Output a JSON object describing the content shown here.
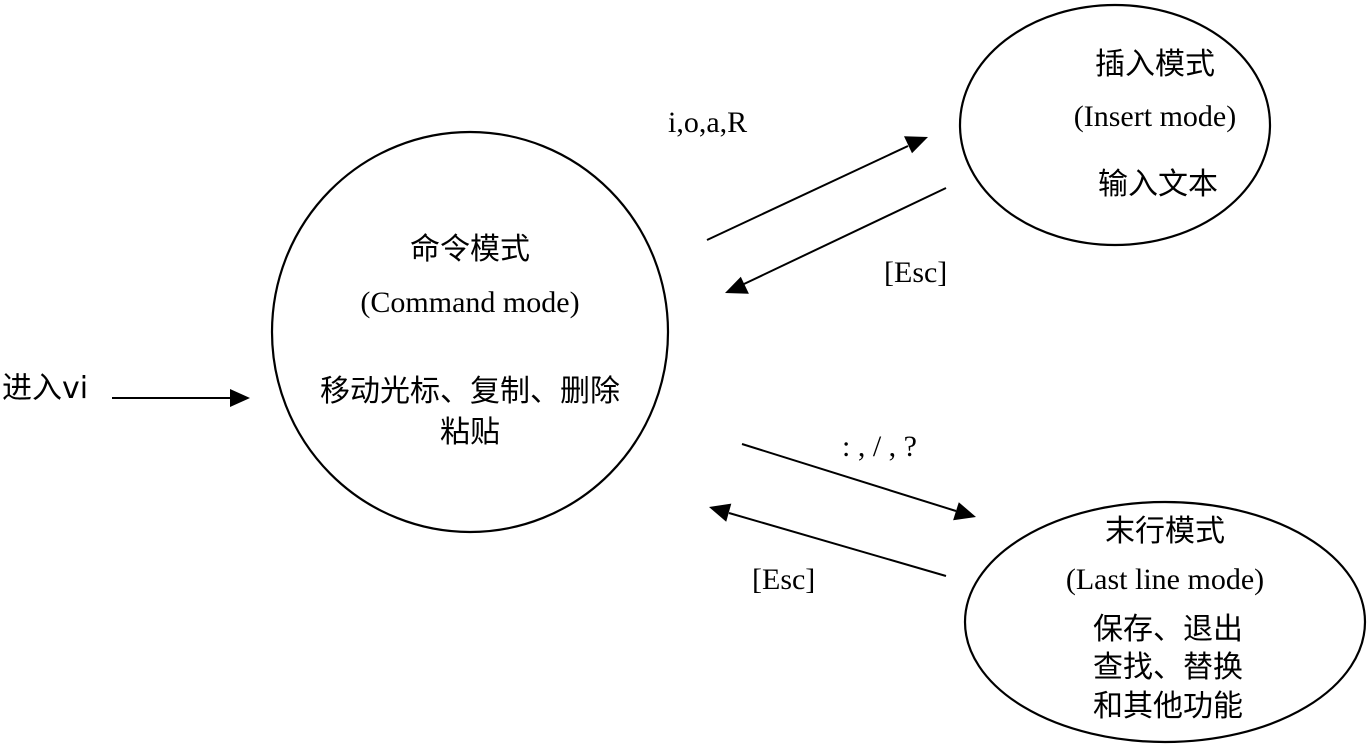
{
  "entry": {
    "label": "进入vi"
  },
  "command_mode": {
    "title": "命令模式",
    "subtitle": "(Command mode)",
    "desc_line1": "移动光标、复制、删除",
    "desc_line2": "粘贴"
  },
  "insert_mode": {
    "title": "插入模式",
    "subtitle": "(Insert mode)",
    "desc": "输入文本"
  },
  "last_line_mode": {
    "title": "末行模式",
    "subtitle": "(Last line mode)",
    "desc_line1": "保存、退出",
    "desc_line2": "查找、替换",
    "desc_line3": "和其他功能"
  },
  "transitions": {
    "to_insert": "i,o,a,R",
    "insert_to_command": "[Esc]",
    "to_last_line": ": , / , ?",
    "last_line_to_command": "[Esc]"
  }
}
